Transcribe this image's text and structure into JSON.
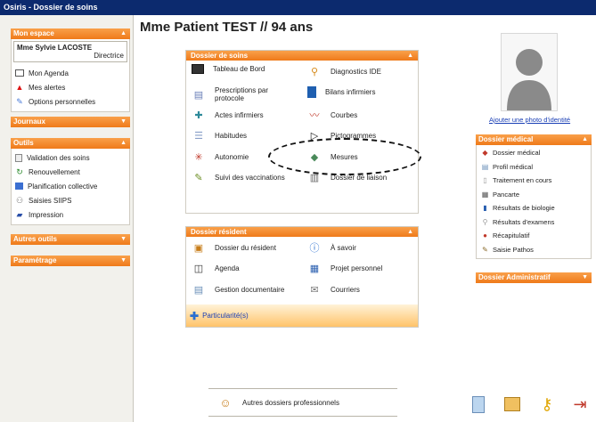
{
  "window": {
    "title": "Osiris - Dossier de soins"
  },
  "patient": {
    "title": "Mme Patient TEST  // 94 ans"
  },
  "sidebar": {
    "mon_espace": {
      "title": "Mon espace",
      "user_name": "Mme Sylvie LACOSTE",
      "user_role": "Directrice",
      "items": [
        {
          "label": "Mon Agenda",
          "icon": "calendar-icon"
        },
        {
          "label": "Mes alertes",
          "icon": "alert-icon"
        },
        {
          "label": "Options personnelles",
          "icon": "settings-icon"
        }
      ]
    },
    "journaux": {
      "title": "Journaux"
    },
    "outils": {
      "title": "Outils",
      "items": [
        {
          "label": "Validation des soins",
          "icon": "validation-icon"
        },
        {
          "label": "Renouvellement",
          "icon": "renew-icon"
        },
        {
          "label": "Planification collective",
          "icon": "planning-icon"
        },
        {
          "label": "Saisies SIIPS",
          "icon": "siips-icon"
        },
        {
          "label": "Impression",
          "icon": "printer-icon"
        }
      ]
    },
    "autres_outils": {
      "title": "Autres outils"
    },
    "parametrage": {
      "title": "Paramétrage"
    }
  },
  "dossier_soins": {
    "title": "Dossier de soins",
    "left_items": [
      {
        "label": "Tableau de Bord",
        "icon": "dashboard-icon"
      },
      {
        "label": "Prescriptions par protocole",
        "icon": "prescription-icon"
      },
      {
        "label": "Actes infirmiers",
        "icon": "nurse-acts-icon"
      },
      {
        "label": "Habitudes",
        "icon": "habits-icon"
      },
      {
        "label": "Autonomie",
        "icon": "autonomy-icon"
      },
      {
        "label": "Suivi des vaccinations",
        "icon": "syringe-icon"
      }
    ],
    "right_items": [
      {
        "label": "Diagnostics IDE",
        "icon": "stethoscope-icon"
      },
      {
        "label": "Bilans infirmiers",
        "icon": "book-icon"
      },
      {
        "label": "Courbes",
        "icon": "chart-icon"
      },
      {
        "label": "Pictogrammes",
        "icon": "pictogram-icon"
      },
      {
        "label": "Mesures",
        "icon": "measures-icon"
      },
      {
        "label": "Dossier de liaison",
        "icon": "liaison-icon"
      }
    ]
  },
  "dossier_resident": {
    "title": "Dossier résident",
    "left_items": [
      {
        "label": "Dossier du résident",
        "icon": "resident-card-icon"
      },
      {
        "label": "Agenda",
        "icon": "agenda-icon"
      },
      {
        "label": "Gestion documentaire",
        "icon": "documents-icon"
      }
    ],
    "right_items": [
      {
        "label": "À savoir",
        "icon": "info-icon"
      },
      {
        "label": "Projet personnel",
        "icon": "project-icon"
      },
      {
        "label": "Courriers",
        "icon": "mail-icon"
      }
    ],
    "footer_label": "Particularité(s)"
  },
  "photo": {
    "link": "Ajouter une photo d'identité"
  },
  "dossier_medical": {
    "title": "Dossier médical",
    "items": [
      {
        "label": "Dossier médical",
        "icon": "medical-file-icon"
      },
      {
        "label": "Profil médical",
        "icon": "profile-icon"
      },
      {
        "label": "Traitement en cours",
        "icon": "treatment-icon"
      },
      {
        "label": "Pancarte",
        "icon": "pancarte-icon"
      },
      {
        "label": "Résultats de biologie",
        "icon": "biology-icon"
      },
      {
        "label": "Résultats d'examens",
        "icon": "exams-icon"
      },
      {
        "label": "Récapitulatif",
        "icon": "summary-icon"
      },
      {
        "label": "Saisie Pathos",
        "icon": "pathos-icon"
      }
    ]
  },
  "dossier_administratif": {
    "title": "Dossier Administratif"
  },
  "autres_dossiers": {
    "label": "Autres dossiers professionnels"
  },
  "colors": {
    "accent": "#ef7a1a",
    "titlebar": "#0c2a6e",
    "link": "#1a3fb5"
  }
}
